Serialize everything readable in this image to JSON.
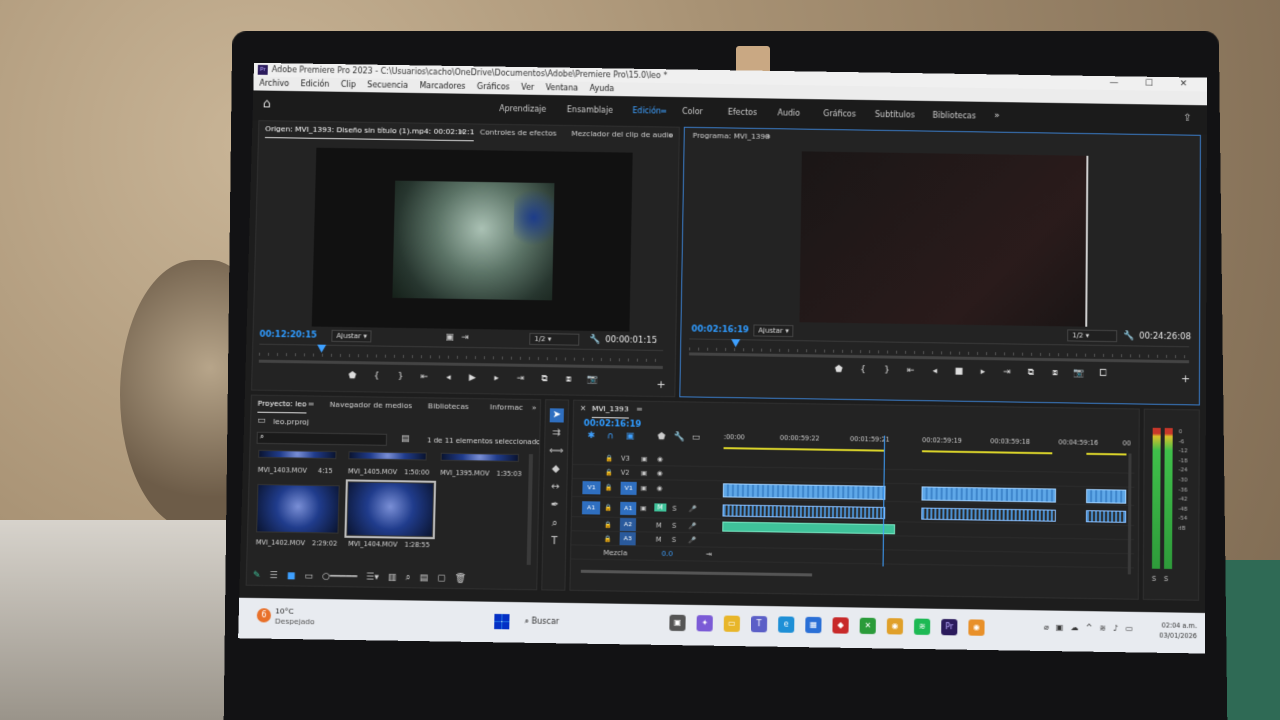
{
  "window": {
    "title": "Adobe Premiere Pro 2023 - C:\\Usuarios\\cacho\\OneDrive\\Documentos\\Adobe\\Premiere Pro\\15.0\\leo *",
    "app_icon": "Pr",
    "controls": "— ☐ ✕"
  },
  "menu": [
    "Archivo",
    "Edición",
    "Clip",
    "Secuencia",
    "Marcadores",
    "Gráficos",
    "Ver",
    "Ventana",
    "Ayuda"
  ],
  "workspaces": {
    "tabs": [
      "Aprendizaje",
      "Ensamblaje",
      "Edición",
      "Color",
      "Efectos",
      "Audio",
      "Gráficos",
      "Subtítulos",
      "Bibliotecas"
    ],
    "active": "Edición",
    "more": "»"
  },
  "source": {
    "tab_origin": "Origen: MVI_1393: Diseño sin título (1).mp4: 00:02:12:1",
    "tab_effects": "Controles de efectos",
    "tab_mixer": "Mezclador del clip de audio",
    "more": "»",
    "timecode": "00:12:20:15",
    "fit": "Ajustar",
    "resolution": "1/2",
    "duration": "00:00:01:15"
  },
  "program": {
    "title": "Programa: MVI_1393",
    "timecode": "00:02:16:19",
    "fit": "Ajustar",
    "resolution": "1/2",
    "duration": "00:24:26:08"
  },
  "project": {
    "tab_project": "Proyecto: leo",
    "tab_media": "Navegador de medios",
    "tab_libraries": "Bibliotecas",
    "tab_info": "Informac",
    "more": "»",
    "file": "leo.prproj",
    "selection_status": "1 de 11 elementos seleccionados",
    "clips_top": [
      {
        "name": "MVI_1403.MOV",
        "duration": "4:15"
      },
      {
        "name": "MVI_1405.MOV",
        "duration": "1:50:00"
      },
      {
        "name": "MVI_1395.MOV",
        "duration": "1:35:03"
      }
    ],
    "clips_bottom": [
      {
        "name": "MVI_1402.MOV",
        "duration": "2:29:02"
      },
      {
        "name": "MVI_1404.MOV",
        "duration": "1:28:55"
      }
    ]
  },
  "timeline": {
    "sequence": "MVI_1393",
    "timecode": "00:02:16:19",
    "ruler": [
      ":00:00",
      "00:00:59:22",
      "00:01:59:21",
      "00:02:59:19",
      "00:03:59:18",
      "00:04:59:16",
      "00"
    ],
    "tracks_video": [
      "V3",
      "V2",
      "V1"
    ],
    "tracks_audio": [
      "A1",
      "A2",
      "A3"
    ],
    "source_v": "V1",
    "source_a": "A1",
    "mute": "M",
    "solo": "S",
    "mix_label": "Mezcla",
    "mix_value": "0.0"
  },
  "meters": {
    "scale": [
      "0",
      "-6",
      "-12",
      "-18",
      "-24",
      "-30",
      "-36",
      "-42",
      "-48",
      "-54",
      "dB"
    ],
    "solo_labels": [
      "S",
      "S"
    ]
  },
  "taskbar": {
    "temperature": "10°C",
    "weather": "Despejado",
    "weather_badge": "6",
    "search": "Buscar",
    "time": "02:04 a.m.",
    "date": "03/01/2026"
  },
  "colors": {
    "accent_blue": "#2f9bff",
    "video_clip": "#5fa8e8",
    "audio_green": "#3fc29a",
    "work_area": "#d9d32a"
  }
}
